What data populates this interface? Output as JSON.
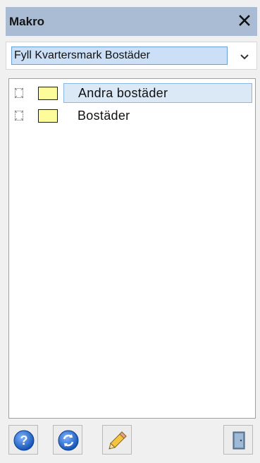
{
  "window": {
    "title": "Makro",
    "close_icon": "close-icon"
  },
  "macro_select": {
    "selected": "Fyll Kvartersmark Bostäder",
    "arrow_icon": "chevron-down-icon"
  },
  "list": {
    "items": [
      {
        "label": "Andra bostäder",
        "checked": false,
        "color": "#fdfc9a",
        "selected": true
      },
      {
        "label": "Bostäder",
        "checked": false,
        "color": "#fdfc9a",
        "selected": false
      }
    ]
  },
  "toolbar": {
    "buttons": [
      {
        "icon": "help-icon"
      },
      {
        "icon": "refresh-icon"
      },
      {
        "icon": "pencil-icon"
      },
      {
        "icon": "exit-door-icon"
      }
    ]
  },
  "colors": {
    "titlebar": "#a9bcd4",
    "selection": "#dbe9f7",
    "swatch": "#fdfc9a"
  }
}
